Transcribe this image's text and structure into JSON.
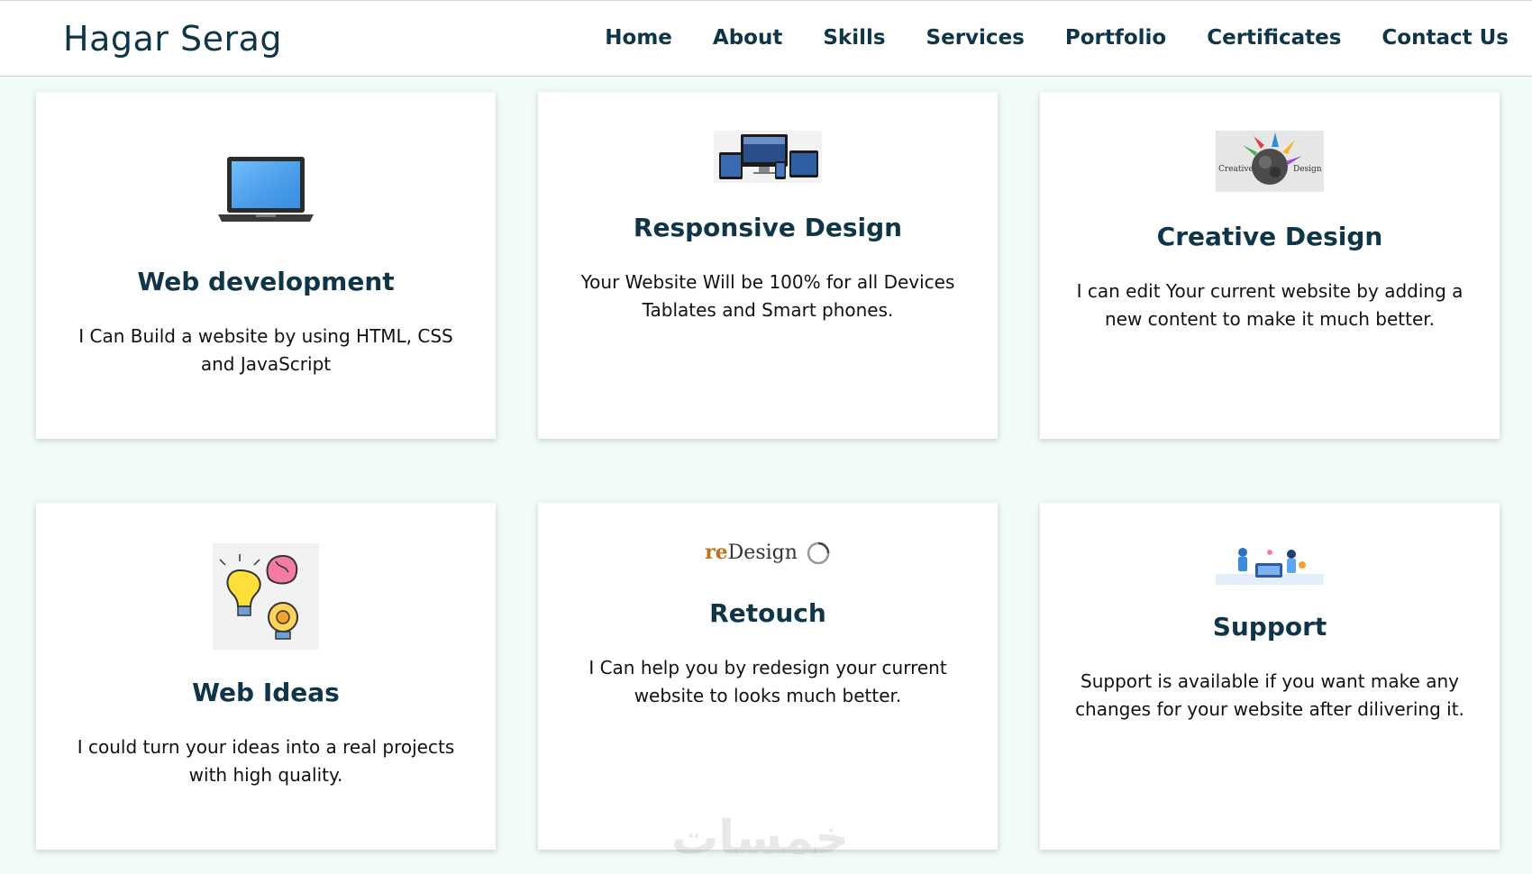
{
  "header": {
    "brand": "Hagar Serag",
    "nav": [
      "Home",
      "About",
      "Skills",
      "Services",
      "Portfolio",
      "Certificates",
      "Contact Us"
    ]
  },
  "cards": [
    {
      "title": "Web development",
      "text": "I Can Build a website by using HTML, CSS and JavaScript",
      "icon": "laptop-icon"
    },
    {
      "title": "Responsive Design",
      "text": "Your Website Will be 100% for all Devices Tablates and Smart phones.",
      "icon": "devices-icon"
    },
    {
      "title": "Creative Design",
      "text": "I can edit Your current website by adding a new content to make it much better.",
      "icon": "creative-design-image",
      "image_words": [
        "Creative",
        "Design"
      ]
    },
    {
      "title": "Web Ideas",
      "text": "I could turn your ideas into a real projects with high quality.",
      "icon": "ideas-icon"
    },
    {
      "title": "Retouch",
      "text": "I Can help you by redesign your current website to looks much better.",
      "icon": "redesign-logo",
      "logo": {
        "prefix": "re",
        "suffix": "Design"
      }
    },
    {
      "title": "Support",
      "text": "Support is available if you want make any changes for your website after dilivering it.",
      "icon": "support-icon"
    }
  ],
  "watermark": "خمسات",
  "colors": {
    "accent": "#0e3548",
    "background": "#f1fbf9",
    "card": "#ffffff",
    "logo_re": "#c4721a"
  }
}
